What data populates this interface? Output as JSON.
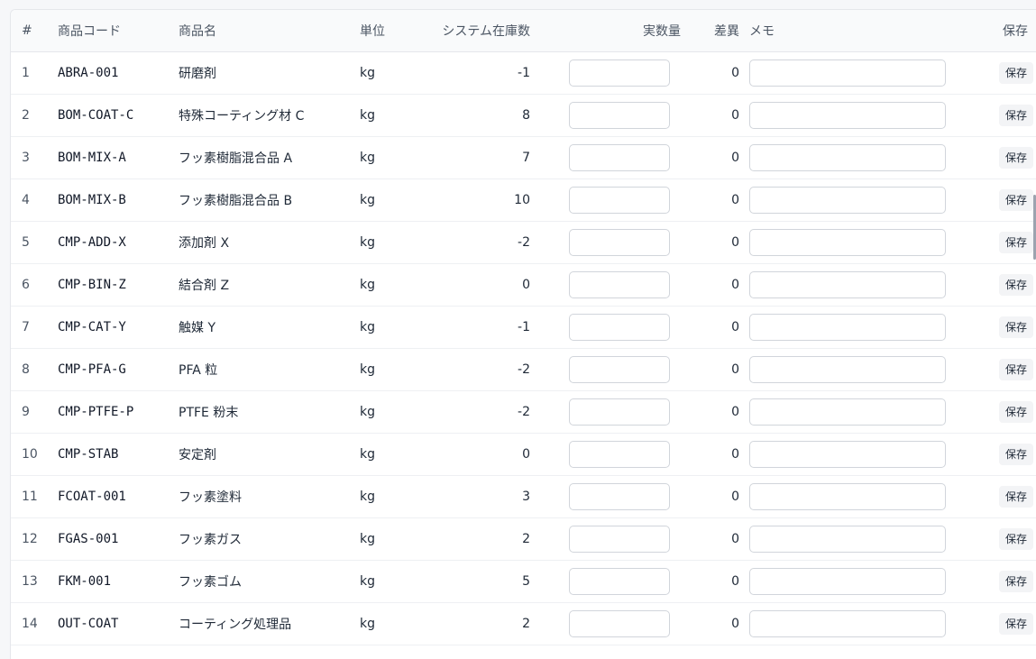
{
  "table": {
    "headers": {
      "num": "#",
      "code": "商品コード",
      "name": "商品名",
      "unit": "単位",
      "system_stock": "システム在庫数",
      "actual_qty": "実数量",
      "difference": "差異",
      "memo": "メモ",
      "save": "保存"
    },
    "rows": [
      {
        "num": "1",
        "code": "ABRA-001",
        "name": "研磨剤",
        "unit": "kg",
        "stock": "-1",
        "actual": "",
        "diff": "0",
        "memo": "",
        "save": "保存"
      },
      {
        "num": "2",
        "code": "BOM-COAT-C",
        "name": "特殊コーティング材 C",
        "unit": "kg",
        "stock": "8",
        "actual": "",
        "diff": "0",
        "memo": "",
        "save": "保存"
      },
      {
        "num": "3",
        "code": "BOM-MIX-A",
        "name": "フッ素樹脂混合品 A",
        "unit": "kg",
        "stock": "7",
        "actual": "",
        "diff": "0",
        "memo": "",
        "save": "保存"
      },
      {
        "num": "4",
        "code": "BOM-MIX-B",
        "name": "フッ素樹脂混合品 B",
        "unit": "kg",
        "stock": "10",
        "actual": "",
        "diff": "0",
        "memo": "",
        "save": "保存"
      },
      {
        "num": "5",
        "code": "CMP-ADD-X",
        "name": "添加剤 X",
        "unit": "kg",
        "stock": "-2",
        "actual": "",
        "diff": "0",
        "memo": "",
        "save": "保存"
      },
      {
        "num": "6",
        "code": "CMP-BIN-Z",
        "name": "結合剤 Z",
        "unit": "kg",
        "stock": "0",
        "actual": "",
        "diff": "0",
        "memo": "",
        "save": "保存"
      },
      {
        "num": "7",
        "code": "CMP-CAT-Y",
        "name": "触媒 Y",
        "unit": "kg",
        "stock": "-1",
        "actual": "",
        "diff": "0",
        "memo": "",
        "save": "保存"
      },
      {
        "num": "8",
        "code": "CMP-PFA-G",
        "name": "PFA 粒",
        "unit": "kg",
        "stock": "-2",
        "actual": "",
        "diff": "0",
        "memo": "",
        "save": "保存"
      },
      {
        "num": "9",
        "code": "CMP-PTFE-P",
        "name": "PTFE 粉末",
        "unit": "kg",
        "stock": "-2",
        "actual": "",
        "diff": "0",
        "memo": "",
        "save": "保存"
      },
      {
        "num": "10",
        "code": "CMP-STAB",
        "name": "安定剤",
        "unit": "kg",
        "stock": "0",
        "actual": "",
        "diff": "0",
        "memo": "",
        "save": "保存"
      },
      {
        "num": "11",
        "code": "FCOAT-001",
        "name": "フッ素塗料",
        "unit": "kg",
        "stock": "3",
        "actual": "",
        "diff": "0",
        "memo": "",
        "save": "保存"
      },
      {
        "num": "12",
        "code": "FGAS-001",
        "name": "フッ素ガス",
        "unit": "kg",
        "stock": "2",
        "actual": "",
        "diff": "0",
        "memo": "",
        "save": "保存"
      },
      {
        "num": "13",
        "code": "FKM-001",
        "name": "フッ素ゴム",
        "unit": "kg",
        "stock": "5",
        "actual": "",
        "diff": "0",
        "memo": "",
        "save": "保存"
      },
      {
        "num": "14",
        "code": "OUT-COAT",
        "name": "コーティング処理品",
        "unit": "kg",
        "stock": "2",
        "actual": "",
        "diff": "0",
        "memo": "",
        "save": "保存"
      }
    ]
  }
}
